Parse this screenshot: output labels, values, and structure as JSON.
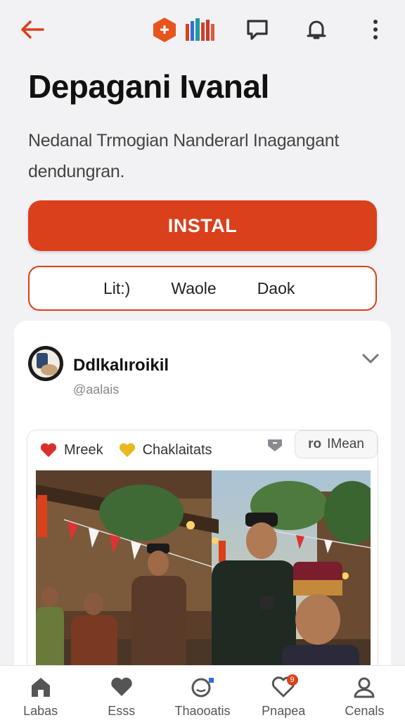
{
  "header": {
    "brand_mark": "✚"
  },
  "app": {
    "title": "Depagani Ivanal",
    "subtitle": "Nedanal Trmogian Nanderarl Inagangant dendungran.",
    "install_label": "INSTAL"
  },
  "segments": [
    "Lit:)",
    "Waole",
    "Daok"
  ],
  "post": {
    "author": "Ddlkalıroikil",
    "handle": "@aalais",
    "reactions": [
      {
        "icon": "heart-icon",
        "color": "#d9302b",
        "label": "Mreek"
      },
      {
        "icon": "heart-icon",
        "color": "#e8b820",
        "label": "Chaklaitats"
      }
    ],
    "mean_prefix": "ro",
    "mean_label": "IMean"
  },
  "nav": [
    {
      "label": "Labas",
      "icon": "home-icon"
    },
    {
      "label": "Esss",
      "icon": "heart-icon"
    },
    {
      "label": "Thaooatis",
      "icon": "chat-icon"
    },
    {
      "label": "Pnapea",
      "icon": "heart-outline-icon",
      "badge": "9"
    },
    {
      "label": "Cenals",
      "icon": "profile-icon"
    }
  ],
  "colors": {
    "accent": "#d9401b",
    "background": "#f2f2f4"
  }
}
